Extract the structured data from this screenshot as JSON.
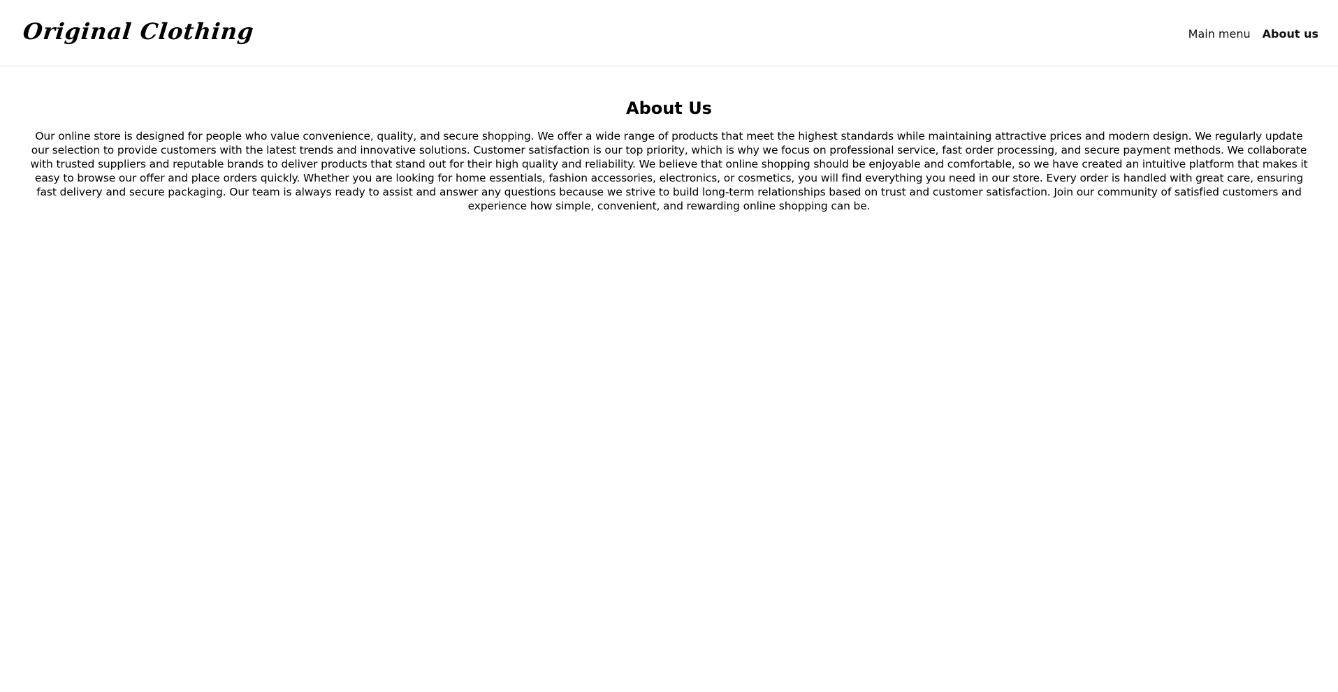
{
  "header": {
    "logo_text": "Original Clothing",
    "nav": {
      "main_menu": "Main menu",
      "about_us": "About us"
    }
  },
  "main": {
    "title": "About Us",
    "paragraph": "Our online store is designed for people who value convenience, quality, and secure shopping. We offer a wide range of products that meet the highest standards while maintaining attractive prices and modern design. We regularly update our selection to provide customers with the latest trends and innovative solutions. Customer satisfaction is our top priority, which is why we focus on professional service, fast order processing, and secure payment methods. We collaborate with trusted suppliers and reputable brands to deliver products that stand out for their high quality and reliability. We believe that online shopping should be enjoyable and comfortable, so we have created an intuitive platform that makes it easy to browse our offer and place orders quickly. Whether you are looking for home essentials, fashion accessories, electronics, or cosmetics, you will find everything you need in our store. Every order is handled with great care, ensuring fast delivery and secure packaging. Our team is always ready to assist and answer any questions because we strive to build long-term relationships based on trust and customer satisfaction. Join our community of satisfied customers and experience how simple, convenient, and rewarding online shopping can be."
  },
  "colors": {
    "background": "#ffffff",
    "text": "#000000",
    "divider": "#e2e2e2"
  }
}
